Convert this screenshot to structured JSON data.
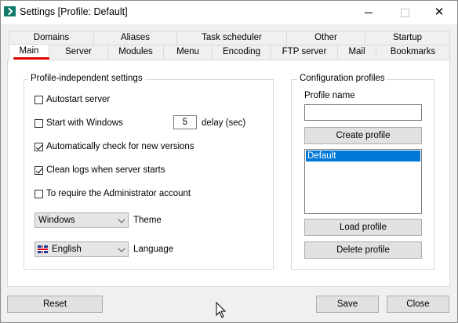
{
  "window": {
    "title": "Settings [Profile: Default]"
  },
  "tabs_row1": [
    "Domains",
    "Aliases",
    "Task scheduler",
    "Other",
    "Startup"
  ],
  "tabs_row2": [
    "Main",
    "Server",
    "Modules",
    "Menu",
    "Encoding",
    "FTP server",
    "Mail",
    "Bookmarks"
  ],
  "active_tab": "Main",
  "profile_independent": {
    "title": "Profile-independent settings",
    "autostart": {
      "label": "Autostart server",
      "checked": false
    },
    "start_with_windows": {
      "label": "Start with Windows",
      "checked": false
    },
    "delay": {
      "value": "5",
      "label": "delay (sec)"
    },
    "auto_check": {
      "label": "Automatically check for new versions",
      "checked": true
    },
    "clean_logs": {
      "label": "Clean logs when server starts",
      "checked": true
    },
    "require_admin": {
      "label": "To require the Administrator account",
      "checked": false
    },
    "theme": {
      "value": "Windows",
      "label": "Theme"
    },
    "language": {
      "value": "English",
      "label": "Language"
    }
  },
  "config_profiles": {
    "title": "Configuration profiles",
    "profile_name_label": "Profile name",
    "profile_name_value": "",
    "create_label": "Create profile",
    "profiles": [
      "Default"
    ],
    "selected_profile": "Default",
    "load_label": "Load profile",
    "delete_label": "Delete profile"
  },
  "footer": {
    "reset_label": "Reset",
    "save_label": "Save",
    "close_label": "Close"
  },
  "colors": {
    "accent": "#0078d7",
    "underline": "#e00000",
    "app_icon": "#0f7a6b"
  }
}
